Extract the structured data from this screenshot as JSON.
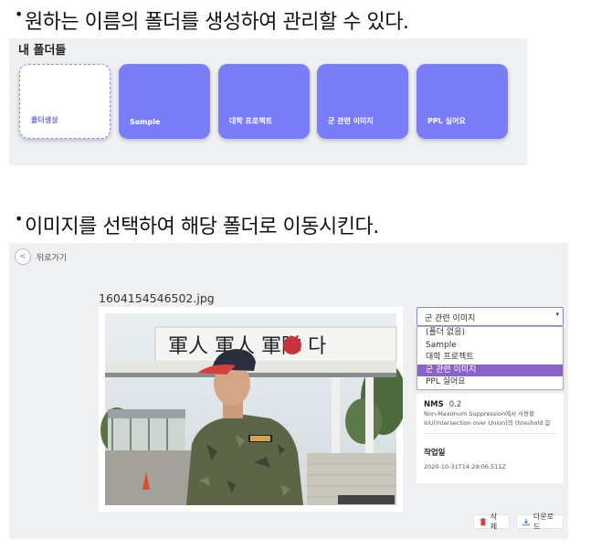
{
  "heading1": {
    "bullet": "•",
    "text": "원하는 이름의 폴더를 생성하여 관리할 수 있다."
  },
  "heading2": {
    "bullet": "•",
    "text": "이미지를 선택하여 해당 폴더로 이동시킨다."
  },
  "folders_panel": {
    "title": "내 폴더들",
    "new_folder_label": "폴더생성",
    "folders": [
      "Sample",
      "대학 프로젝트",
      "군 관련 이미지",
      "PPL 실어요"
    ]
  },
  "detail": {
    "back_label": "뒤로가기",
    "filename": "1604154546502.jpg",
    "photo_sign_text": "軍人 軍人 軍隊 다",
    "folder_select": {
      "value": "군 관련 이미지",
      "options": [
        "(폴더 없음)",
        "Sample",
        "대학 프로젝트",
        "군 관련 이미지",
        "PPL 실어요"
      ],
      "selected_index": 3
    },
    "nms_label": "NMS",
    "nms_value": "0.2",
    "nms_desc_line1": "Non-Maximum Suppression에서 사용할",
    "nms_desc_line2": "IoU(Intersection over Union)의 threshold 값",
    "created_label": "작업일",
    "created_value": "2020-10-31T14:29:06.511Z",
    "delete_label": "삭제",
    "download_label": "다운로드"
  },
  "colors": {
    "folder_purple": "#7b7cf7",
    "panel_bg": "#eef0f2",
    "selected_option": "#8a63c8"
  }
}
